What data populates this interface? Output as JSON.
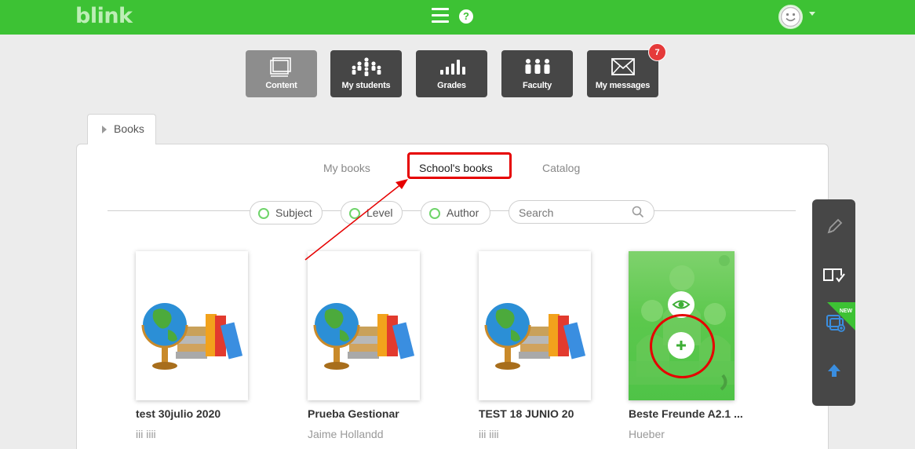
{
  "header": {
    "logo": "blink",
    "menu_icon": "hamburger-icon",
    "help_icon": "help-icon",
    "help_glyph": "?",
    "avatar_icon": "smiley-avatar-icon"
  },
  "nav": {
    "content_label": "Content",
    "students_label": "My students",
    "grades_label": "Grades",
    "faculty_label": "Faculty",
    "messages_label": "My messages",
    "messages_badge": "7"
  },
  "books_tab": {
    "label": "Books"
  },
  "subtabs": {
    "my_books": "My books",
    "school_books": "School's books",
    "catalog": "Catalog"
  },
  "filters": {
    "subject": "Subject",
    "level": "Level",
    "author": "Author",
    "search_placeholder": "Search"
  },
  "books": [
    {
      "title": "test 30julio 2020",
      "author": "iii iiii"
    },
    {
      "title": "Prueba Gestionar",
      "author": "Jaime Hollandd"
    },
    {
      "title": "TEST 18 JUNIO 20",
      "author": "iii iiii"
    },
    {
      "title": "Beste Freunde A2.1 ...",
      "author": "Hueber"
    }
  ],
  "side_tools": {
    "new_label": "NEW",
    "icons": [
      "pencil-icon",
      "book-check-icon",
      "windows-add-icon",
      "arrow-up-icon"
    ]
  },
  "colors": {
    "brand_green": "#3dc234",
    "highlight_red": "#e60000",
    "tile_dark": "#464646",
    "tile_active": "#8d8d8d"
  }
}
